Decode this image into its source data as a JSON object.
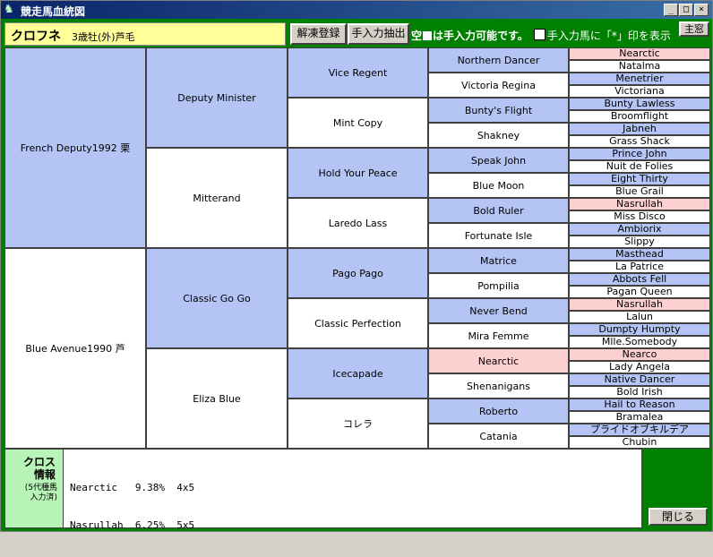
{
  "window": {
    "title": "競走馬血統図",
    "controls": {
      "minimize": "_",
      "maximize": "□",
      "close": "×"
    }
  },
  "header": {
    "horse_name": "クロフネ",
    "horse_info": "3歳牡(外)芦毛",
    "btn_freeze": "解凍登録",
    "btn_extract": "手入力抽出",
    "note_bold": "空",
    "note_bold_rest": "は手入力可能です。",
    "note_checkbox_label": "手入力馬に「*」印を表示",
    "btn_tools": "主窓"
  },
  "pedigree": {
    "gen1": [
      {
        "name": "French Deputy",
        "sub": "1992 栗"
      },
      {
        "name": "Blue Avenue",
        "sub": "1990 芦"
      }
    ],
    "gen2": [
      "Deputy Minister",
      "Mitterand",
      "Classic Go Go",
      "Eliza Blue"
    ],
    "gen3": [
      "Vice Regent",
      "Mint Copy",
      "Hold Your Peace",
      "Laredo Lass",
      "Pago Pago",
      "Classic Perfection",
      "Icecapade",
      "コレラ"
    ],
    "gen4": [
      "Northern Dancer",
      "Victoria Regina",
      "Bunty's Flight",
      "Shakney",
      "Speak John",
      "Blue Moon",
      "Bold Ruler",
      "Fortunate Isle",
      "Matrice",
      "Pompilia",
      "Never Bend",
      "Mira Femme",
      "Nearctic",
      "Shenanigans",
      "Roberto",
      "Catania"
    ],
    "gen5": [
      "Nearctic",
      "Natalma",
      "Menetrier",
      "Victoriana",
      "Bunty Lawless",
      "Broomflight",
      "Jabneh",
      "Grass Shack",
      "Prince John",
      "Nuit de Folies",
      "Eight Thirty",
      "Blue Grail",
      "Nasrullah",
      "Miss Disco",
      "Ambiorix",
      "Slippy",
      "Masthead",
      "La Patrice",
      "Abbots Fell",
      "Pagan Queen",
      "Nasrullah",
      "Lalun",
      "Dumpty Humpty",
      "Mlle.Somebody",
      "Nearco",
      "Lady Angela",
      "Native Dancer",
      "Bold Irish",
      "Hail to Reason",
      "Bramalea",
      "プライドオブキルデア",
      "Chubin"
    ],
    "highlight": [
      "Nearctic",
      "Nasrullah",
      "Nearco"
    ]
  },
  "cross": {
    "title_l1": "クロス",
    "title_l2": "情報",
    "note_l1": "(5代種馬",
    "note_l2": "入力済)",
    "lines": [
      "Nearctic   9.38%  4x5",
      "Nasrullah  6.25%  5x5"
    ]
  },
  "footer": {
    "close_button": "閉じる"
  },
  "colors": {
    "sire_fill": "#b4c4f4",
    "dam_fill": "#ffffff",
    "cross_fill": "#fcd0d0",
    "background": "#008000"
  }
}
